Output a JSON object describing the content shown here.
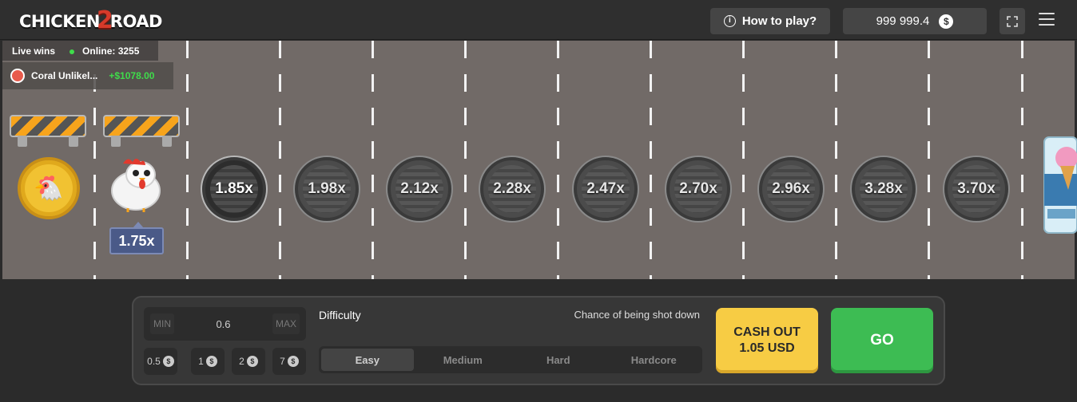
{
  "header": {
    "logo_left": "CHICKEN",
    "logo_mid": "2",
    "logo_right": "ROAD",
    "how_to_play": "How to play?",
    "balance": "999 999.4",
    "currency_symbol": "$"
  },
  "live": {
    "label": "Live wins",
    "online": "Online: 3255",
    "winner_name": "Coral Unlikel...",
    "winner_amount": "+$1078.00"
  },
  "game": {
    "current_multiplier": "1.75x",
    "lanes": [
      "1.85x",
      "1.98x",
      "2.12x",
      "2.28x",
      "2.47x",
      "2.70x",
      "2.96x",
      "3.28x",
      "3.70x"
    ]
  },
  "controls": {
    "min_label": "MIN",
    "max_label": "MAX",
    "bet_value": "0.6",
    "chips": [
      "0.5",
      "1",
      "2",
      "7"
    ],
    "chip_currency": "$",
    "difficulty_label": "Difficulty",
    "chance_label": "Chance of being shot down",
    "difficulties": [
      "Easy",
      "Medium",
      "Hard",
      "Hardcore"
    ],
    "selected_difficulty": "Easy",
    "cashout_line1": "CASH OUT",
    "cashout_line2": "1.05 USD",
    "go_label": "GO"
  },
  "colors": {
    "road": "#716a67",
    "go": "#3dbc53",
    "cashout": "#f7cc44",
    "win": "#3fdc4b"
  }
}
